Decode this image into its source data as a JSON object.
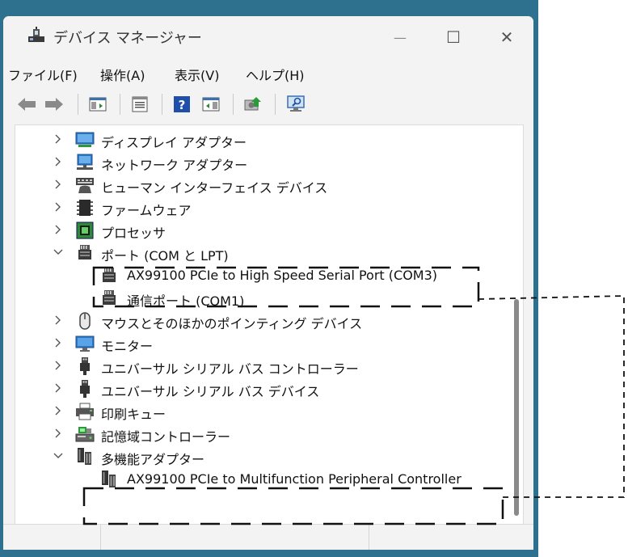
{
  "window": {
    "title": "デバイス マネージャー",
    "minimize_glyph": "—",
    "maximize_glyph": "☐",
    "close_glyph": "✕"
  },
  "menu": [
    "ファイル(F)",
    "操作(A)",
    "表示(V)",
    "ヘルプ(H)"
  ],
  "toolbar": {
    "icons": [
      "back-arrow-icon",
      "forward-arrow-icon",
      "show-hide-console-tree-icon",
      "properties-icon",
      "help-icon",
      "action-pane-icon",
      "update-driver-icon",
      "scan-hardware-icon"
    ]
  },
  "tree": [
    {
      "label": "ディスプレイ アダプター",
      "expanded": false,
      "icon": "display-adapter-icon"
    },
    {
      "label": "ネットワーク アダプター",
      "expanded": false,
      "icon": "network-adapter-icon"
    },
    {
      "label": "ヒューマン インターフェイス デバイス",
      "expanded": false,
      "icon": "hid-icon"
    },
    {
      "label": "ファームウェア",
      "expanded": false,
      "icon": "firmware-icon"
    },
    {
      "label": "プロセッサ",
      "expanded": false,
      "icon": "processor-icon"
    },
    {
      "label": "ポート (COM と LPT)",
      "expanded": true,
      "icon": "port-icon",
      "children": [
        {
          "label": "AX99100 PCIe to High Speed Serial Port (COM3)",
          "icon": "port-icon"
        },
        {
          "label": "通信ポート (COM1)",
          "icon": "port-icon"
        }
      ]
    },
    {
      "label": "マウスとそのほかのポインティング デバイス",
      "expanded": false,
      "icon": "mouse-icon"
    },
    {
      "label": "モニター",
      "expanded": false,
      "icon": "monitor-icon"
    },
    {
      "label": "ユニバーサル シリアル バス コントローラー",
      "expanded": false,
      "icon": "usb-icon"
    },
    {
      "label": "ユニバーサル シリアル バス デバイス",
      "expanded": false,
      "icon": "usb-icon"
    },
    {
      "label": "印刷キュー",
      "expanded": false,
      "icon": "printer-icon"
    },
    {
      "label": "記憶域コントローラー",
      "expanded": false,
      "icon": "storage-controller-icon"
    },
    {
      "label": "多機能アダプター",
      "expanded": true,
      "icon": "multifunction-adapter-icon",
      "children": [
        {
          "label": "AX99100 PCIe to Multifunction Peripheral Controller",
          "icon": "multifunction-adapter-icon"
        }
      ]
    }
  ]
}
